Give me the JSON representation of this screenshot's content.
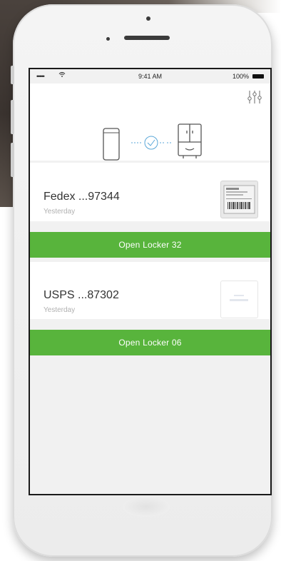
{
  "status_bar": {
    "signal": "•••••",
    "time": "9:41 AM",
    "battery": "100%"
  },
  "header": {
    "filter_icon": "sliders-icon",
    "phone_icon": "smartphone-icon",
    "link_icon": "check-circle-icon",
    "locker_icon": "locker-icon"
  },
  "packages": [
    {
      "carrier": "Fedex ...97344",
      "date": "Yesterday",
      "thumbnail": "shipping-label-thumbnail",
      "action_label": "Open Locker 32"
    },
    {
      "carrier": "USPS ...87302",
      "date": "Yesterday",
      "thumbnail": "package-label-thumbnail",
      "action_label": "Open Locker 06"
    }
  ],
  "colors": {
    "accent_green": "#58b43c",
    "link_blue": "#5aa7d8",
    "screen_bg": "#f1f1f1"
  }
}
